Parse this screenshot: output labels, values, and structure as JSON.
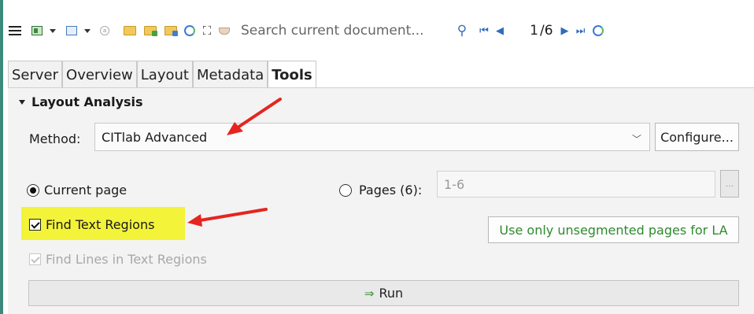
{
  "toolbar": {
    "icons": [
      "menu-icon",
      "image-icon",
      "dropdown-icon",
      "page-icon",
      "dropdown-icon",
      "info-icon",
      "folder-open-icon",
      "folder-green-icon",
      "folder-blue-icon",
      "sync-icon",
      "binoculars-icon",
      "cup-icon"
    ],
    "search_placeholder": "Search current document...",
    "current_page": "1",
    "total_pages": "/6",
    "accent_color": "#2f6cc0"
  },
  "tabs": [
    {
      "label": "Server",
      "active": false
    },
    {
      "label": "Overview",
      "active": false
    },
    {
      "label": "Layout",
      "active": false
    },
    {
      "label": "Metadata",
      "active": false
    },
    {
      "label": "Tools",
      "active": true
    }
  ],
  "section": {
    "title": "Layout Analysis",
    "method_label": "Method:",
    "method_value": "CITlab Advanced",
    "configure_label": "Configure...",
    "current_page_label": "Current page",
    "current_page_selected": true,
    "pages_label": "Pages (6):",
    "pages_value": "1-6",
    "pages_button_label": "...",
    "find_text_regions_label": "Find Text Regions",
    "find_text_regions_checked": true,
    "unsegmented_label": "Use only unsegmented pages for LA",
    "find_lines_label": "Find Lines in Text Regions",
    "find_lines_checked": true,
    "run_label": "Run",
    "run_icon": "arrow-right-icon"
  },
  "colors": {
    "highlight": "#f3f339",
    "annotation_arrow": "#e52520",
    "unsegmented_text": "#2e8b2e",
    "frame_left": "#3d8a7c"
  }
}
